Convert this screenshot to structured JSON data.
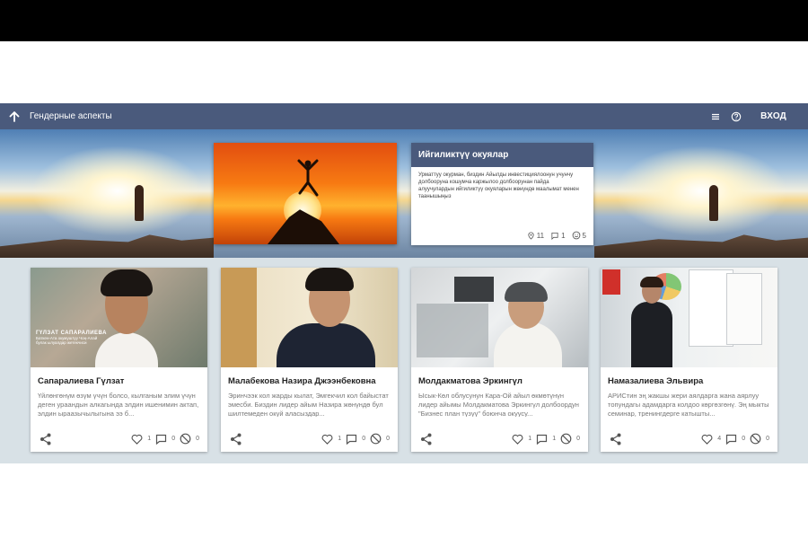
{
  "app_bar": {
    "title": "Гендерные аспекты",
    "login": "ВХОД",
    "color": "#4a5a7c"
  },
  "feature": {
    "title": "Ийгиликтүү окуялар",
    "text": "Урматтуу окурман, биздин Айылды инвестициялоонун учунчу долбооруна кошумча каржылоо долбоорунан пайда алуучулардын ийгиликтүү окуяларын жөнүндө маалымат менен таанышыңыз",
    "stats": {
      "places": "11",
      "comments": "1",
      "likes": "5"
    }
  },
  "cards": [
    {
      "name": "Сапаралиева Гүлзат",
      "description": "Үйлөнгөнүм өзүм үчүн болсо, кылганым элим үчүн деген ураандын алкагында элдин ишенимин актап, элдин ыраазычылыгына ээ б...",
      "photo_caption_name": "ГҮЛЗАТ САПАРАЛИЕВА",
      "photo_caption_sub": "Баткен-Ата окумуштуу Чоң-Алай булак ылуалдар жетекчиси",
      "likes": "1",
      "comments": "0",
      "blocked": "0"
    },
    {
      "name": "Малабекова Назира Джээнбековна",
      "description": "Эринчээк кол жарды кылат, Эмгекчил кол байыстат эмесби. Биздин лидер айым Назира жөнүндө бул шилтемеден окуй аласыздар...",
      "likes": "1",
      "comments": "0",
      "blocked": "0"
    },
    {
      "name": "Молдакматова Эркингүл",
      "description": "Ысык-Көл облусунун Кара-Ой айыл өкмөтүнүн лидер айымы Молдакматова Эркингүл долбоордун \"Бизнес план түзүү\" боюнча окуусу...",
      "likes": "1",
      "comments": "1",
      "blocked": "0"
    },
    {
      "name": "Намазалиева Эльвира",
      "description": "АРИСтин эң жакшы жери аялдарга жана аярлуу топундагы адамдарга колдоо көргөзгөнү. Эң мыкты семинар, тренингдерге катышты...",
      "likes": "4",
      "comments": "0",
      "blocked": "0"
    }
  ],
  "icons": {
    "back": "arrow-up-icon",
    "menu": "menu-icon",
    "help": "help-circle-icon",
    "place": "map-pin-icon",
    "comment": "comment-icon",
    "like": "heart-icon",
    "share": "share-icon",
    "block": "block-icon",
    "reaction": "smile-icon"
  }
}
